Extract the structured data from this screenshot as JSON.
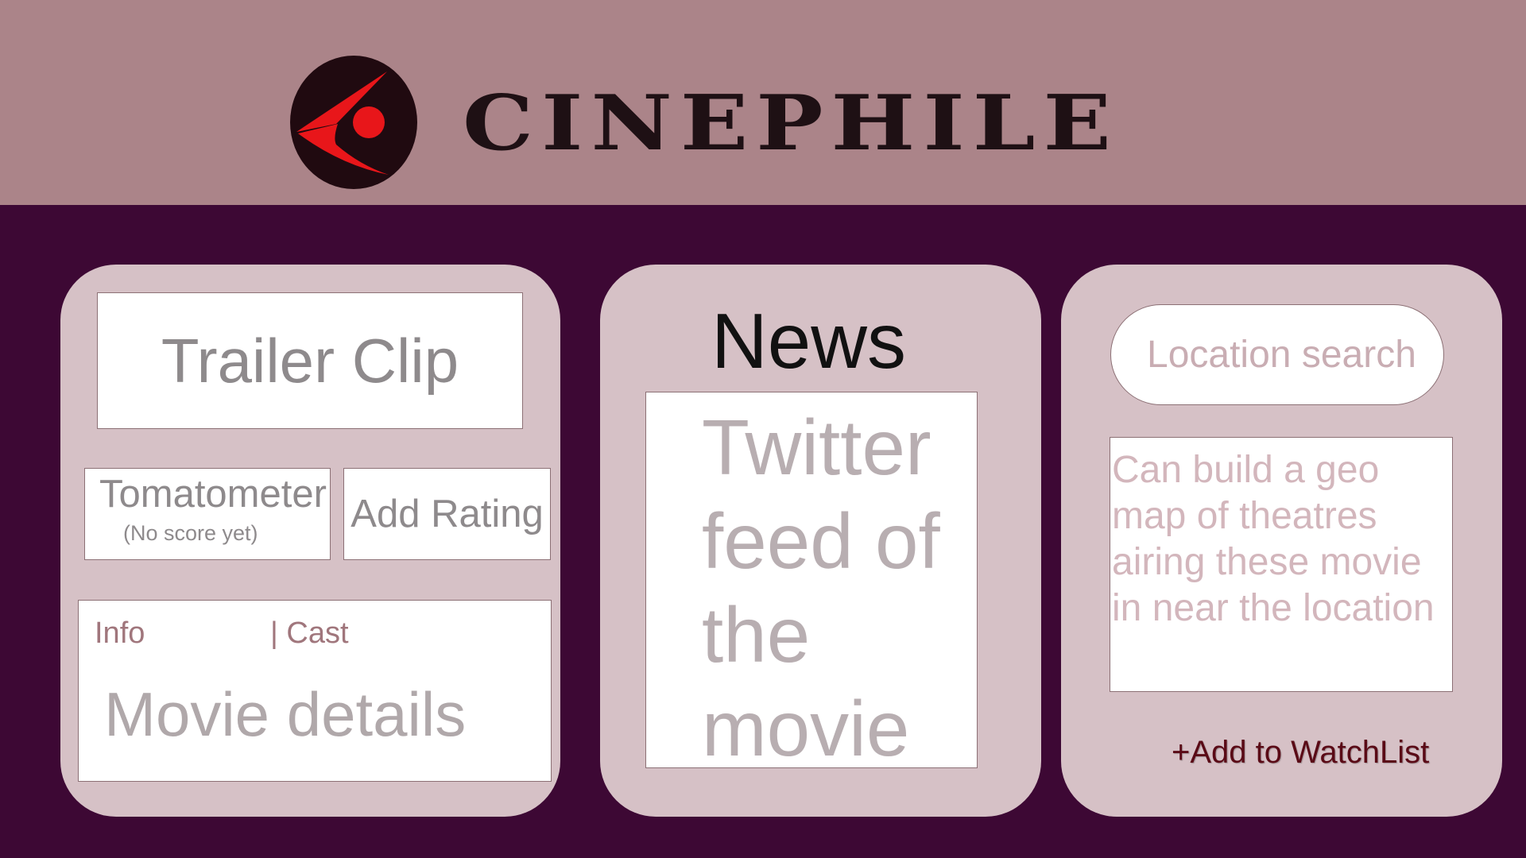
{
  "header": {
    "brand": "CINEPHILE",
    "logo_icon": "cinephile-eye-logo-icon"
  },
  "colors": {
    "header_bg": "#ab8489",
    "page_bg": "#3d0834",
    "card_bg": "#d6c1c6",
    "logo_red": "#e8161a",
    "logo_dark": "#200a10"
  },
  "left_panel": {
    "trailer_label": "Trailer Clip",
    "tomatometer_label": "Tomatometer",
    "tomatometer_score": "(No score yet)",
    "add_rating_label": "Add Rating",
    "tabs": {
      "info": "Info",
      "cast": "| Cast"
    },
    "details_text": "Movie details"
  },
  "middle_panel": {
    "title": "News",
    "feed_text": "Twitter feed of the movie"
  },
  "right_panel": {
    "search_placeholder": "Location search",
    "map_text": "Can build a geo map of theatres airing these movie in near the location",
    "watchlist_label": "+Add to WatchList"
  }
}
